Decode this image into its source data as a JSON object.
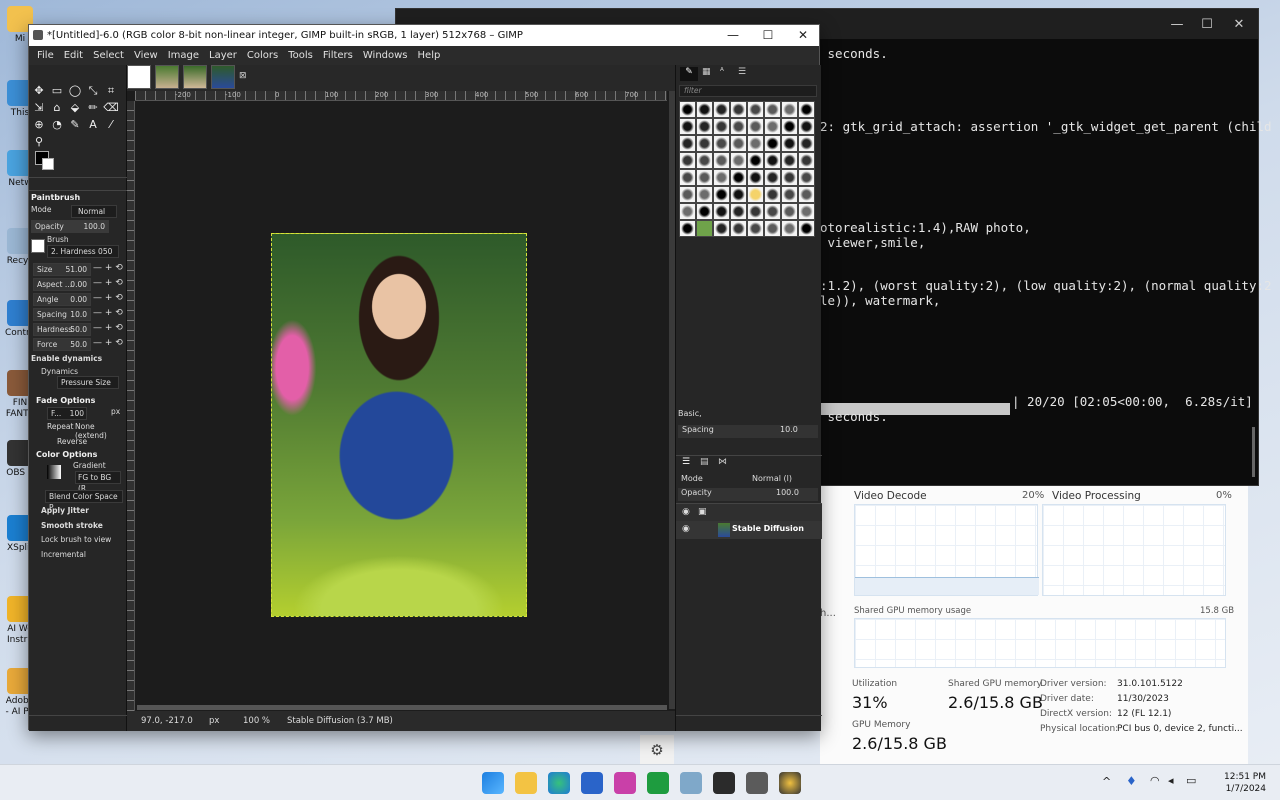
{
  "desktop": {
    "icons": [
      {
        "label": "Mi",
        "color": "#f2c14e"
      },
      {
        "label": "This",
        "color": "#3c8fd6"
      },
      {
        "label": "Netw",
        "color": "#4aa3df"
      },
      {
        "label": "Recyc",
        "color": "#9bb7d4"
      },
      {
        "label": "Contro",
        "color": "#2f7fd0"
      },
      {
        "label": "FIN FANTA",
        "color": "#8a5a3a"
      },
      {
        "label": "OBS S",
        "color": "#333333"
      },
      {
        "label": "XSplit",
        "color": "#1b7fd1"
      },
      {
        "label": "AI Wo Instru",
        "color": "#f0b429"
      },
      {
        "label": "Adobe - AI Ph",
        "color": "#e8a93a"
      }
    ]
  },
  "terminal": {
    "lines": [
      " seconds.",
      "2: gtk_grid_attach: assertion '_gtk_widget_get_parent (child",
      "otorealistic:1.4),RAW photo,",
      " viewer,smile,",
      ":1.2), (worst quality:2), (low quality:2), (normal quality:2",
      "le)), watermark,",
      " seconds."
    ],
    "progress_text": "| 20/20 [02:05<00:00,  6.28s/it]",
    "controls": {
      "minimize": "—",
      "maximize": "☐",
      "close": "✕"
    }
  },
  "taskmgr": {
    "video_decode": "Video Decode",
    "video_decode_pct": "20%",
    "video_processing": "Video Processing",
    "video_processing_pct": "0%",
    "shared_gpu_label": "Shared GPU memory usage",
    "shared_gpu_total": "15.8 GB",
    "utilization_label": "Utilization",
    "utilization_value": "31%",
    "shared_gpu_mem_label": "Shared GPU memory",
    "shared_gpu_mem_value": "2.6/15.8 GB",
    "gpu_memory_label": "GPU Memory",
    "gpu_memory_value": "2.6/15.8 GB",
    "details": [
      {
        "key": "Driver version:",
        "value": "31.0.101.5122"
      },
      {
        "key": "Driver date:",
        "value": "11/30/2023"
      },
      {
        "key": "DirectX version:",
        "value": "12 (FL 12.1)"
      },
      {
        "key": "Physical location:",
        "value": "PCI bus 0, device 2, functi..."
      }
    ],
    "side_glyph": "h...",
    "gear": "⚙"
  },
  "gimp": {
    "title": "*[Untitled]-6.0 (RGB color 8-bit non-linear integer, GIMP built-in sRGB, 1 layer) 512x768 – GIMP",
    "controls": {
      "minimize": "—",
      "maximize": "☐",
      "close": "✕"
    },
    "menu": [
      "File",
      "Edit",
      "Select",
      "View",
      "Image",
      "Layer",
      "Colors",
      "Tools",
      "Filters",
      "Windows",
      "Help"
    ],
    "tool_options": {
      "tool_name": "Paintbrush",
      "mode_label": "Mode",
      "mode_value": "Normal",
      "opacity_label": "Opacity",
      "opacity_value": "100.0",
      "brush_label": "Brush",
      "brush_value": "2. Hardness 050",
      "rows": [
        {
          "label": "Size",
          "value": "51.00"
        },
        {
          "label": "Aspect ...",
          "value": "0.00"
        },
        {
          "label": "Angle",
          "value": "0.00"
        },
        {
          "label": "Spacing",
          "value": "10.0"
        },
        {
          "label": "Hardness",
          "value": "50.0"
        },
        {
          "label": "Force",
          "value": "50.0"
        }
      ],
      "enable_dynamics": "Enable dynamics",
      "dynamics_label": "Dynamics",
      "dynamics_value": "Pressure Size",
      "fade_options": "Fade Options",
      "fade_length_label": "F...",
      "fade_length_value": "100",
      "fade_unit": "px",
      "repeat_label": "Repeat",
      "repeat_value": "None (extend)",
      "reverse": "Reverse",
      "color_options": "Color Options",
      "gradient_label": "Gradient",
      "gradient_value": "FG to BG (R",
      "blend_space": "Blend Color Space P...",
      "apply_jitter": "Apply Jitter",
      "smooth_stroke": "Smooth stroke",
      "lock_brush": "Lock brush to view",
      "incremental": "Incremental"
    },
    "rulers": [
      "-200",
      "-100",
      "0",
      "100",
      "200",
      "300",
      "400",
      "500",
      "600",
      "700"
    ],
    "status": {
      "coords": "97.0, -217.0",
      "unit": "px",
      "zoom": "100 %",
      "info": "Stable Diffusion (3.7 MB)"
    },
    "dock": {
      "filter_placeholder": "filter",
      "preset": "Basic,",
      "spacing_label": "Spacing",
      "spacing_value": "10.0",
      "mode_label": "Mode",
      "mode_value": "Normal (l)",
      "opacity_label": "Opacity",
      "opacity_value": "100.0",
      "layer_name": "Stable Diffusion"
    }
  },
  "taskbar": {
    "time": "12:51 PM",
    "date": "1/7/2024",
    "tray_chevron": "^"
  }
}
